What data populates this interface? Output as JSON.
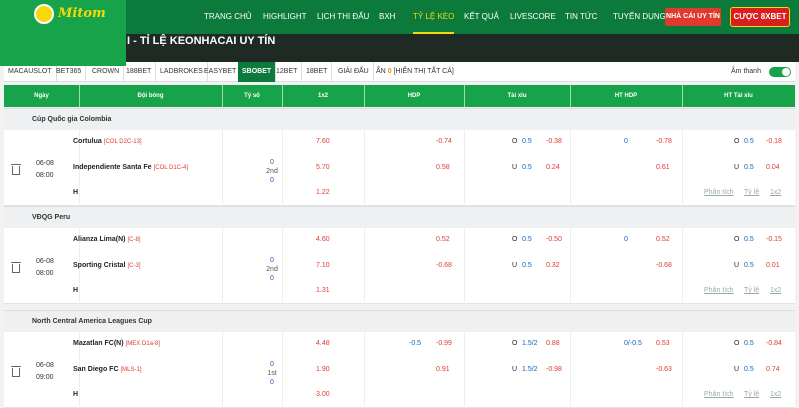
{
  "brand": {
    "name": "Mitom"
  },
  "nav": [
    "TRANG CHỦ",
    "HIGHLIGHT",
    "LỊCH THI ĐẤU",
    "BXH",
    "TỶ LỆ KÈO",
    "KẾT QUẢ",
    "LIVESCORE",
    "TIN TỨC",
    "TUYỂN DỤNG"
  ],
  "nav_active": "TỶ LỆ KÈO",
  "cta": {
    "partner": "NHÀ CÁI UY TÍN",
    "bet": "CƯỢC 8XBET"
  },
  "banner_title": "I - TỈ LỆ KEONHACAI UY TÍN",
  "bookmakers": [
    "MACAUSLOT",
    "BET365",
    "CROWN",
    "188BET",
    "LADBROKES",
    "EASYBET",
    "SBOBET",
    "12BET",
    "18BET",
    "GIẢI ĐẤU"
  ],
  "bookmaker_active": "SBOBET",
  "filter": {
    "prefix": "ẨN",
    "count": "0",
    "show_all": "[HIỂN THỊ TẤT CẢ]"
  },
  "sound_label": "Âm thanh",
  "columns": [
    "Ngày",
    "Đội bóng",
    "Tỷ số",
    "1x2",
    "HDP",
    "Tài xỉu",
    "HT HDP",
    "HT Tài xỉu"
  ],
  "links": {
    "analysis": "Phân tích",
    "odds": "Tỷ lệ",
    "x12": "1x2"
  },
  "leagues": [
    {
      "name": "Cúp Quốc gia Colombia",
      "date": "06-08",
      "time": "08:00",
      "score": {
        "home": "0",
        "status": "2nd",
        "away": "0"
      },
      "home": {
        "name": "Cortulua",
        "tag": "[COL D2C-13]",
        "x12": "7.60",
        "hdp_line": "",
        "hdp_odds": "-0.74",
        "tx_side": "O",
        "tx_line": "0.5",
        "tx_odds": "-0.38",
        "hthdp_line": "0",
        "hthdp_odds": "-0.78",
        "httx_side": "O",
        "httx_line": "0.5",
        "httx_odds": "-0.18"
      },
      "away": {
        "name": "Independiente Santa Fe",
        "tag": "[COL D1C-4]",
        "x12": "5.70",
        "hdp_line": "",
        "hdp_odds": "0.58",
        "tx_side": "U",
        "tx_line": "0.5",
        "tx_odds": "0.24",
        "hthdp_line": "",
        "hthdp_odds": "0.61",
        "httx_side": "U",
        "httx_line": "0.5",
        "httx_odds": "0.04"
      },
      "draw": {
        "label": "H",
        "x12": "1.22"
      }
    },
    {
      "name": "VĐQG Peru",
      "date": "06-08",
      "time": "08:00",
      "score": {
        "home": "0",
        "status": "2nd",
        "away": "0"
      },
      "home": {
        "name": "Alianza Lima(N)",
        "tag": "[C-8]",
        "x12": "4.60",
        "hdp_line": "",
        "hdp_odds": "0.52",
        "tx_side": "O",
        "tx_line": "0.5",
        "tx_odds": "-0.50",
        "hthdp_line": "0",
        "hthdp_odds": "0.52",
        "httx_side": "O",
        "httx_line": "0.5",
        "httx_odds": "-0.15"
      },
      "away": {
        "name": "Sporting Cristal",
        "tag": "[C-3]",
        "x12": "7.10",
        "hdp_line": "",
        "hdp_odds": "-0.68",
        "tx_side": "U",
        "tx_line": "0.5",
        "tx_odds": "0.32",
        "hthdp_line": "",
        "hthdp_odds": "-0.68",
        "httx_side": "U",
        "httx_line": "0.5",
        "httx_odds": "0.01"
      },
      "draw": {
        "label": "H",
        "x12": "1.31"
      }
    },
    {
      "name": "North Central America Leagues Cup",
      "date": "06-08",
      "time": "09:00",
      "score": {
        "home": "0",
        "status": "1st",
        "away": "0"
      },
      "home": {
        "name": "Mazatlan FC(N)",
        "tag": "[MEX D1a-8]",
        "x12": "4.48",
        "hdp_line": "-0.5",
        "hdp_odds": "-0.99",
        "tx_side": "O",
        "tx_line": "1.5/2",
        "tx_odds": "0.88",
        "hthdp_line": "0/-0.5",
        "hthdp_odds": "0.53",
        "httx_side": "O",
        "httx_line": "0.5",
        "httx_odds": "-0.84"
      },
      "away": {
        "name": "San Diego FC",
        "tag": "[MLS-1]",
        "x12": "1.90",
        "hdp_line": "",
        "hdp_odds": "0.91",
        "tx_side": "U",
        "tx_line": "1.5/2",
        "tx_odds": "-0.98",
        "hthdp_line": "",
        "hthdp_odds": "-0.63",
        "httx_side": "U",
        "httx_line": "0.5",
        "httx_odds": "0.74"
      },
      "draw": {
        "label": "H",
        "x12": "3.00"
      }
    }
  ]
}
